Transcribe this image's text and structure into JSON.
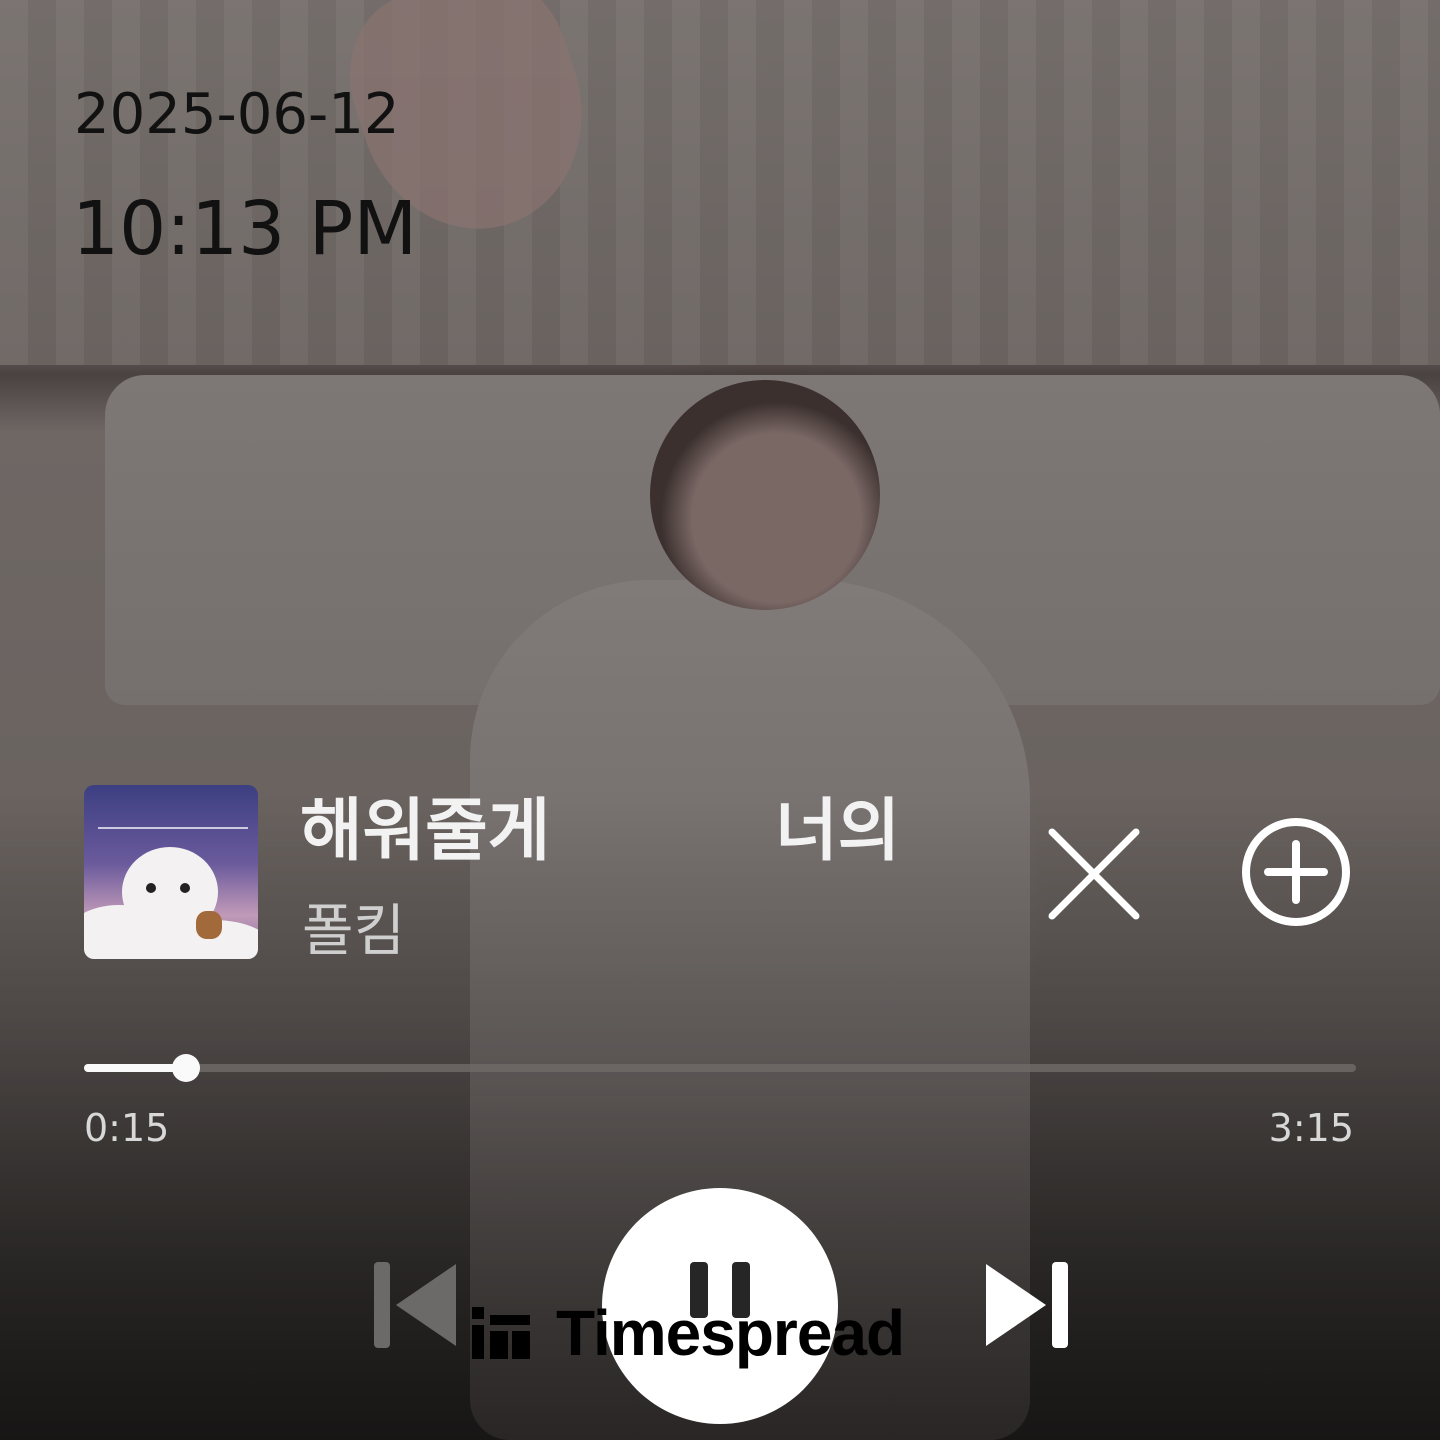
{
  "clock": {
    "date": "2025-06-12",
    "time": "10:13 PM"
  },
  "now_playing": {
    "title_segment_1": "해워줄게",
    "title_segment_2": "너의",
    "artist": "폴킴",
    "album_art_icon": "album-cover-bear-icon"
  },
  "actions": {
    "close_icon": "close-icon",
    "add_icon": "plus-circle-icon"
  },
  "progress": {
    "elapsed": "0:15",
    "duration": "3:15",
    "fraction": 0.08
  },
  "controls": {
    "previous_icon": "skip-previous-icon",
    "pause_icon": "pause-icon",
    "next_icon": "skip-next-icon"
  },
  "watermark": {
    "text": "Timespread"
  },
  "colors": {
    "text_dark": "#111111",
    "text_light": "#f2f2f2",
    "artist_text": "#cfcfcf",
    "progress_fill": "#fafafa",
    "progress_track": "#6e6967"
  }
}
